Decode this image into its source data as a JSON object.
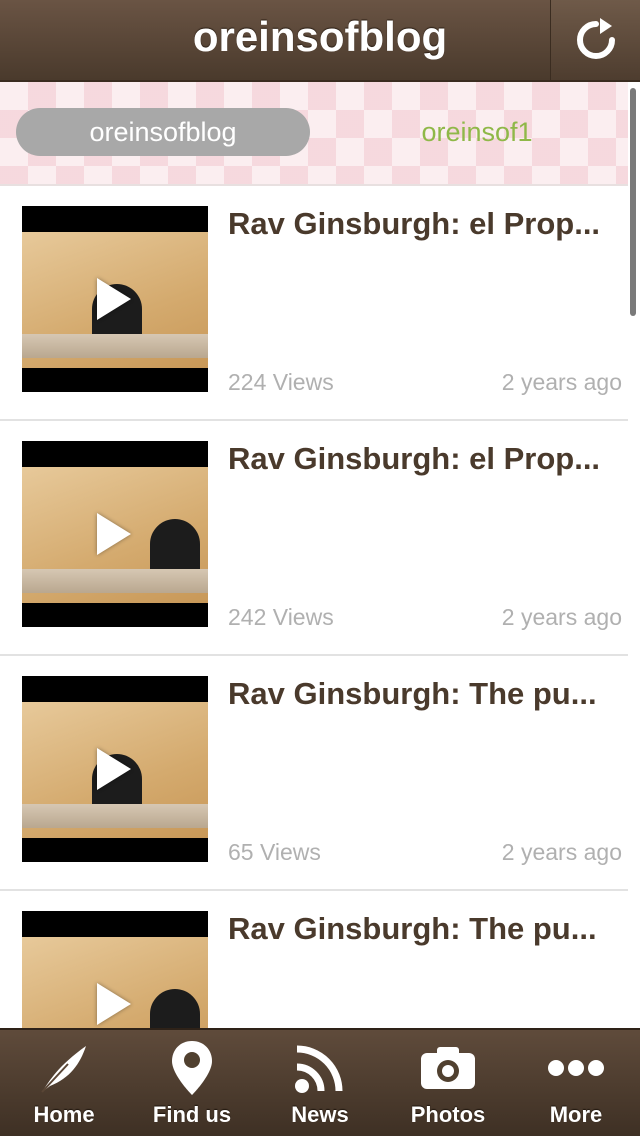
{
  "header": {
    "title": "oreinsofblog",
    "refresh_icon": "refresh-icon"
  },
  "tabs": [
    {
      "label": "oreinsofblog",
      "active": true
    },
    {
      "label": "oreinsof1",
      "active": false
    }
  ],
  "videos": [
    {
      "title": "Rav Ginsburgh: el Prop...",
      "views": "224 Views",
      "age": "2 years ago"
    },
    {
      "title": "Rav Ginsburgh: el Prop...",
      "views": "242 Views",
      "age": "2 years ago"
    },
    {
      "title": "Rav Ginsburgh: The pu...",
      "views": "65 Views",
      "age": "2 years ago"
    },
    {
      "title": "Rav Ginsburgh: The pu...",
      "views": "",
      "age": ""
    }
  ],
  "bottom_nav": [
    {
      "label": "Home",
      "icon": "feather-icon"
    },
    {
      "label": "Find us",
      "icon": "map-pin-icon"
    },
    {
      "label": "News",
      "icon": "rss-icon"
    },
    {
      "label": "Photos",
      "icon": "camera-icon"
    },
    {
      "label": "More",
      "icon": "more-dots-icon"
    }
  ],
  "colors": {
    "header_brown": "#4a3a2c",
    "tab_active_bg": "#a8a8a8",
    "tab_inactive_text": "#8fb848",
    "title_text": "#4a3a2c",
    "meta_text": "#b0b0b0"
  }
}
